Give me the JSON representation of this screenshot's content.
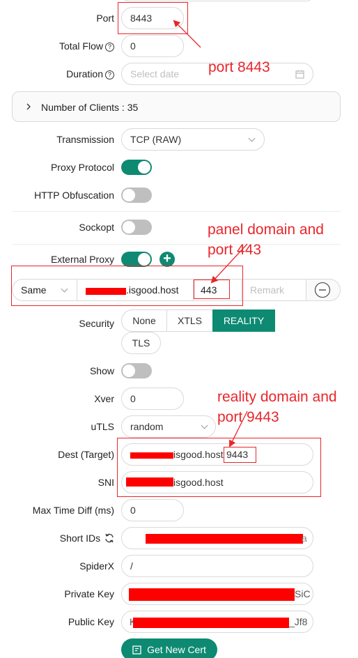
{
  "form": {
    "port": {
      "label": "Port",
      "value": "8443"
    },
    "total_flow": {
      "label": "Total Flow",
      "value": "0"
    },
    "duration": {
      "label": "Duration",
      "placeholder": "Select date"
    },
    "clients": {
      "label": "Number of Clients : 35"
    },
    "transmission": {
      "label": "Transmission",
      "value": "TCP (RAW)"
    },
    "proxy_protocol": {
      "label": "Proxy Protocol",
      "on": true
    },
    "http_obfuscation": {
      "label": "HTTP Obfuscation",
      "on": false
    },
    "sockopt": {
      "label": "Sockopt",
      "on": false
    },
    "external_proxy": {
      "label": "External Proxy",
      "on": true,
      "mode": "Same",
      "host_suffix": ".isgood.host",
      "port": "443",
      "remark_placeholder": "Remark"
    },
    "security": {
      "label": "Security",
      "options": [
        "None",
        "XTLS",
        "REALITY",
        "TLS"
      ],
      "selected": "REALITY"
    },
    "show": {
      "label": "Show",
      "on": false
    },
    "xver": {
      "label": "Xver",
      "value": "0"
    },
    "utls": {
      "label": "uTLS",
      "value": "random"
    },
    "dest": {
      "label": "Dest (Target)",
      "host_suffix": "isgood.host",
      "port": "9443"
    },
    "sni": {
      "label": "SNI",
      "value_suffix": "isgood.host"
    },
    "max_time_diff": {
      "label": "Max Time Diff (ms)",
      "value": "0"
    },
    "short_ids": {
      "label": "Short IDs",
      "value_tail": "a"
    },
    "spiderx": {
      "label": "SpiderX",
      "value": "/"
    },
    "private_key": {
      "label": "Private Key",
      "value_tail": "SiC"
    },
    "public_key": {
      "label": "Public Key",
      "value_head": "K",
      "value_tail": "_Jf8"
    },
    "get_cert_button": "Get New Cert"
  },
  "annotations": {
    "port": "port 8443",
    "panel_line1": "panel domain and",
    "panel_line2": "port  443",
    "reality_line1": "reality domain and",
    "reality_line2": "port  9443"
  },
  "colors": {
    "accent": "#0e8a73",
    "annotation": "#e8262b",
    "redaction": "#ff0000"
  }
}
